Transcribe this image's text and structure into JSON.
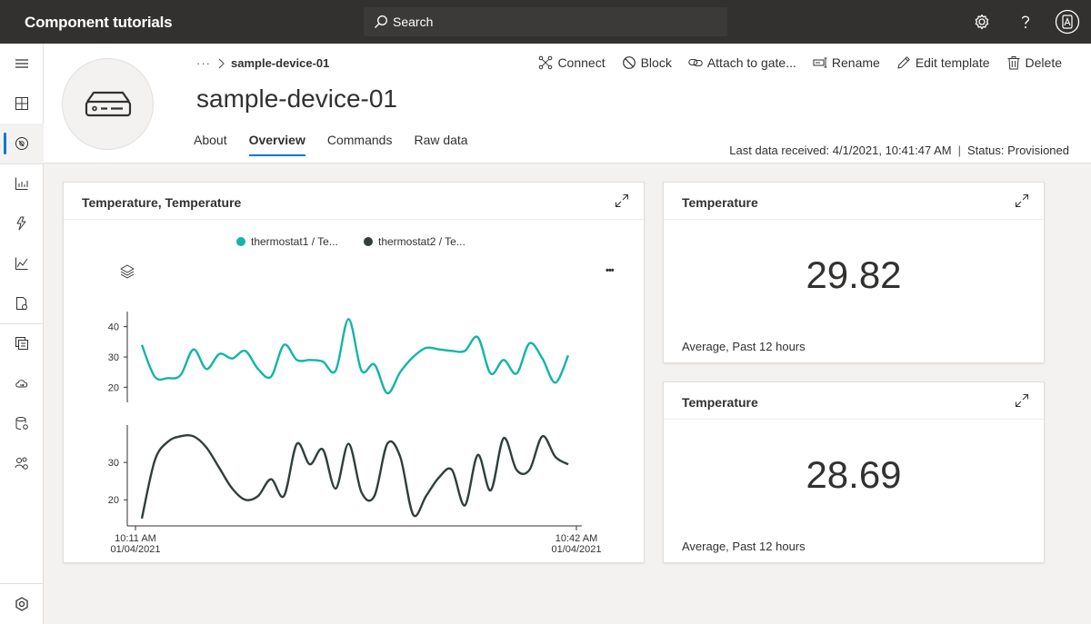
{
  "topbar": {
    "app_title": "Component tutorials",
    "search_label": "Search"
  },
  "breadcrumb": {
    "ellipsis": "···",
    "current": "sample-device-01"
  },
  "device": {
    "title": "sample-device-01"
  },
  "actions": {
    "connect": "Connect",
    "block": "Block",
    "attach": "Attach to gate...",
    "rename": "Rename",
    "edit_template": "Edit template",
    "delete": "Delete"
  },
  "tabs": [
    {
      "label": "About"
    },
    {
      "label": "Overview"
    },
    {
      "label": "Commands"
    },
    {
      "label": "Raw data"
    }
  ],
  "status": {
    "last_data": "Last data received: 4/1/2021, 10:41:47 AM",
    "separator": "|",
    "state": "Status: Provisioned"
  },
  "line_card": {
    "title": "Temperature, Temperature",
    "more": "•••"
  },
  "kpi1": {
    "title": "Temperature",
    "value": "29.82",
    "caption": "Average, Past 12 hours"
  },
  "kpi2": {
    "title": "Temperature",
    "value": "28.69",
    "caption": "Average, Past 12 hours"
  },
  "colors": {
    "accent": "#0078d4",
    "series1": "#13b5a5",
    "series2": "#323e3e",
    "topbar": "#323130"
  },
  "chart_data": {
    "type": "line",
    "x_range": [
      "01/04/2021 10:11 AM",
      "01/04/2021 10:42 AM"
    ],
    "x_tick_labels": [
      {
        "time": "10:11 AM",
        "date": "01/04/2021"
      },
      {
        "time": "10:42 AM",
        "date": "01/04/2021"
      }
    ],
    "series": [
      {
        "name": "thermostat1 / Te...",
        "legend_label": "thermostat1 / Te...",
        "color": "#13b5a5",
        "ylim": [
          15,
          45
        ],
        "yticks": [
          20,
          30,
          40
        ],
        "values": [
          34,
          23.5,
          23,
          24,
          32.5,
          26,
          31,
          29.5,
          32,
          26,
          23.5,
          34,
          29,
          29,
          28.5,
          25.5,
          42.5,
          25.5,
          27.5,
          18,
          25,
          30,
          33,
          32.5,
          32,
          32,
          36.5,
          24.5,
          29,
          24.5,
          34.5,
          29.5,
          21.5,
          30.5
        ]
      },
      {
        "name": "thermostat2 / Te...",
        "legend_label": "thermostat2 / Te...",
        "color": "#323e3e",
        "ylim": [
          13,
          40
        ],
        "yticks": [
          20,
          30
        ],
        "values": [
          15,
          30.5,
          35.5,
          37,
          37,
          34,
          28.5,
          23,
          20,
          21,
          25.5,
          21,
          35,
          29.5,
          33.5,
          23,
          35,
          22,
          21,
          35,
          31.5,
          16,
          21,
          26,
          28,
          18.5,
          32,
          22.5,
          36.5,
          28,
          28,
          37,
          31.5,
          29.5
        ]
      }
    ]
  }
}
